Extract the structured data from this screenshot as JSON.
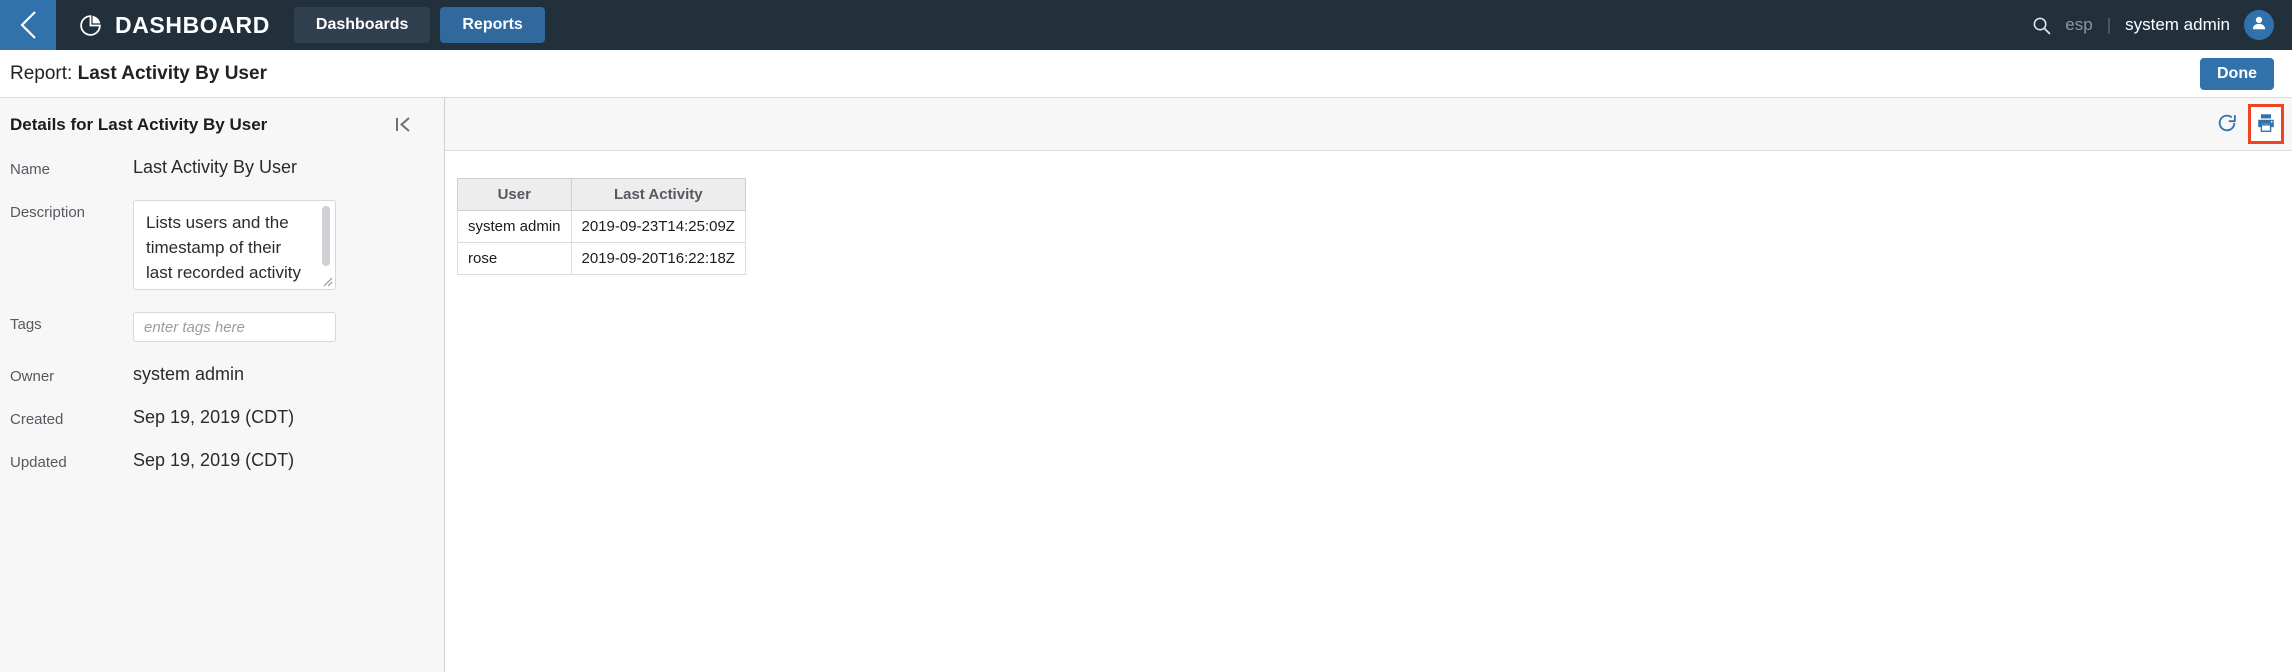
{
  "topbar": {
    "back_icon": "chevron-left-icon",
    "brand_icon": "pie-chart-icon",
    "brand_title": "DASHBOARD",
    "nav": [
      {
        "label": "Dashboards",
        "active": false
      },
      {
        "label": "Reports",
        "active": true
      }
    ],
    "search_icon": "search-icon",
    "locale": "esp",
    "divider": "|",
    "username": "system admin",
    "avatar_icon": "user-avatar-icon",
    "bg_color": "#22303c",
    "accent_color": "#3172ad"
  },
  "title_row": {
    "label": "Report:",
    "value": "Last Activity By User",
    "done_label": "Done"
  },
  "details": {
    "header": "Details for Last Activity By User",
    "collapse_icon": "collapse-panel-icon",
    "fields": {
      "name_label": "Name",
      "name_value": "Last Activity By User",
      "description_label": "Description",
      "description_value": "Lists users and the timestamp of their last recorded activity in the system.",
      "tags_label": "Tags",
      "tags_value": "",
      "tags_placeholder": "enter tags here",
      "owner_label": "Owner",
      "owner_value": "system admin",
      "created_label": "Created",
      "created_value": "Sep 19, 2019 (CDT)",
      "updated_label": "Updated",
      "updated_value": "Sep 19, 2019 (CDT)"
    }
  },
  "content": {
    "toolbar": {
      "refresh_icon": "refresh-icon",
      "print_icon": "print-icon",
      "highlight_color": "#ee4422",
      "icon_color": "#3172ad"
    },
    "table": {
      "columns": [
        "User",
        "Last Activity"
      ],
      "rows": [
        {
          "user": "system admin",
          "last_activity": "2019-09-23T14:25:09Z"
        },
        {
          "user": "rose",
          "last_activity": "2019-09-20T16:22:18Z"
        }
      ]
    }
  }
}
